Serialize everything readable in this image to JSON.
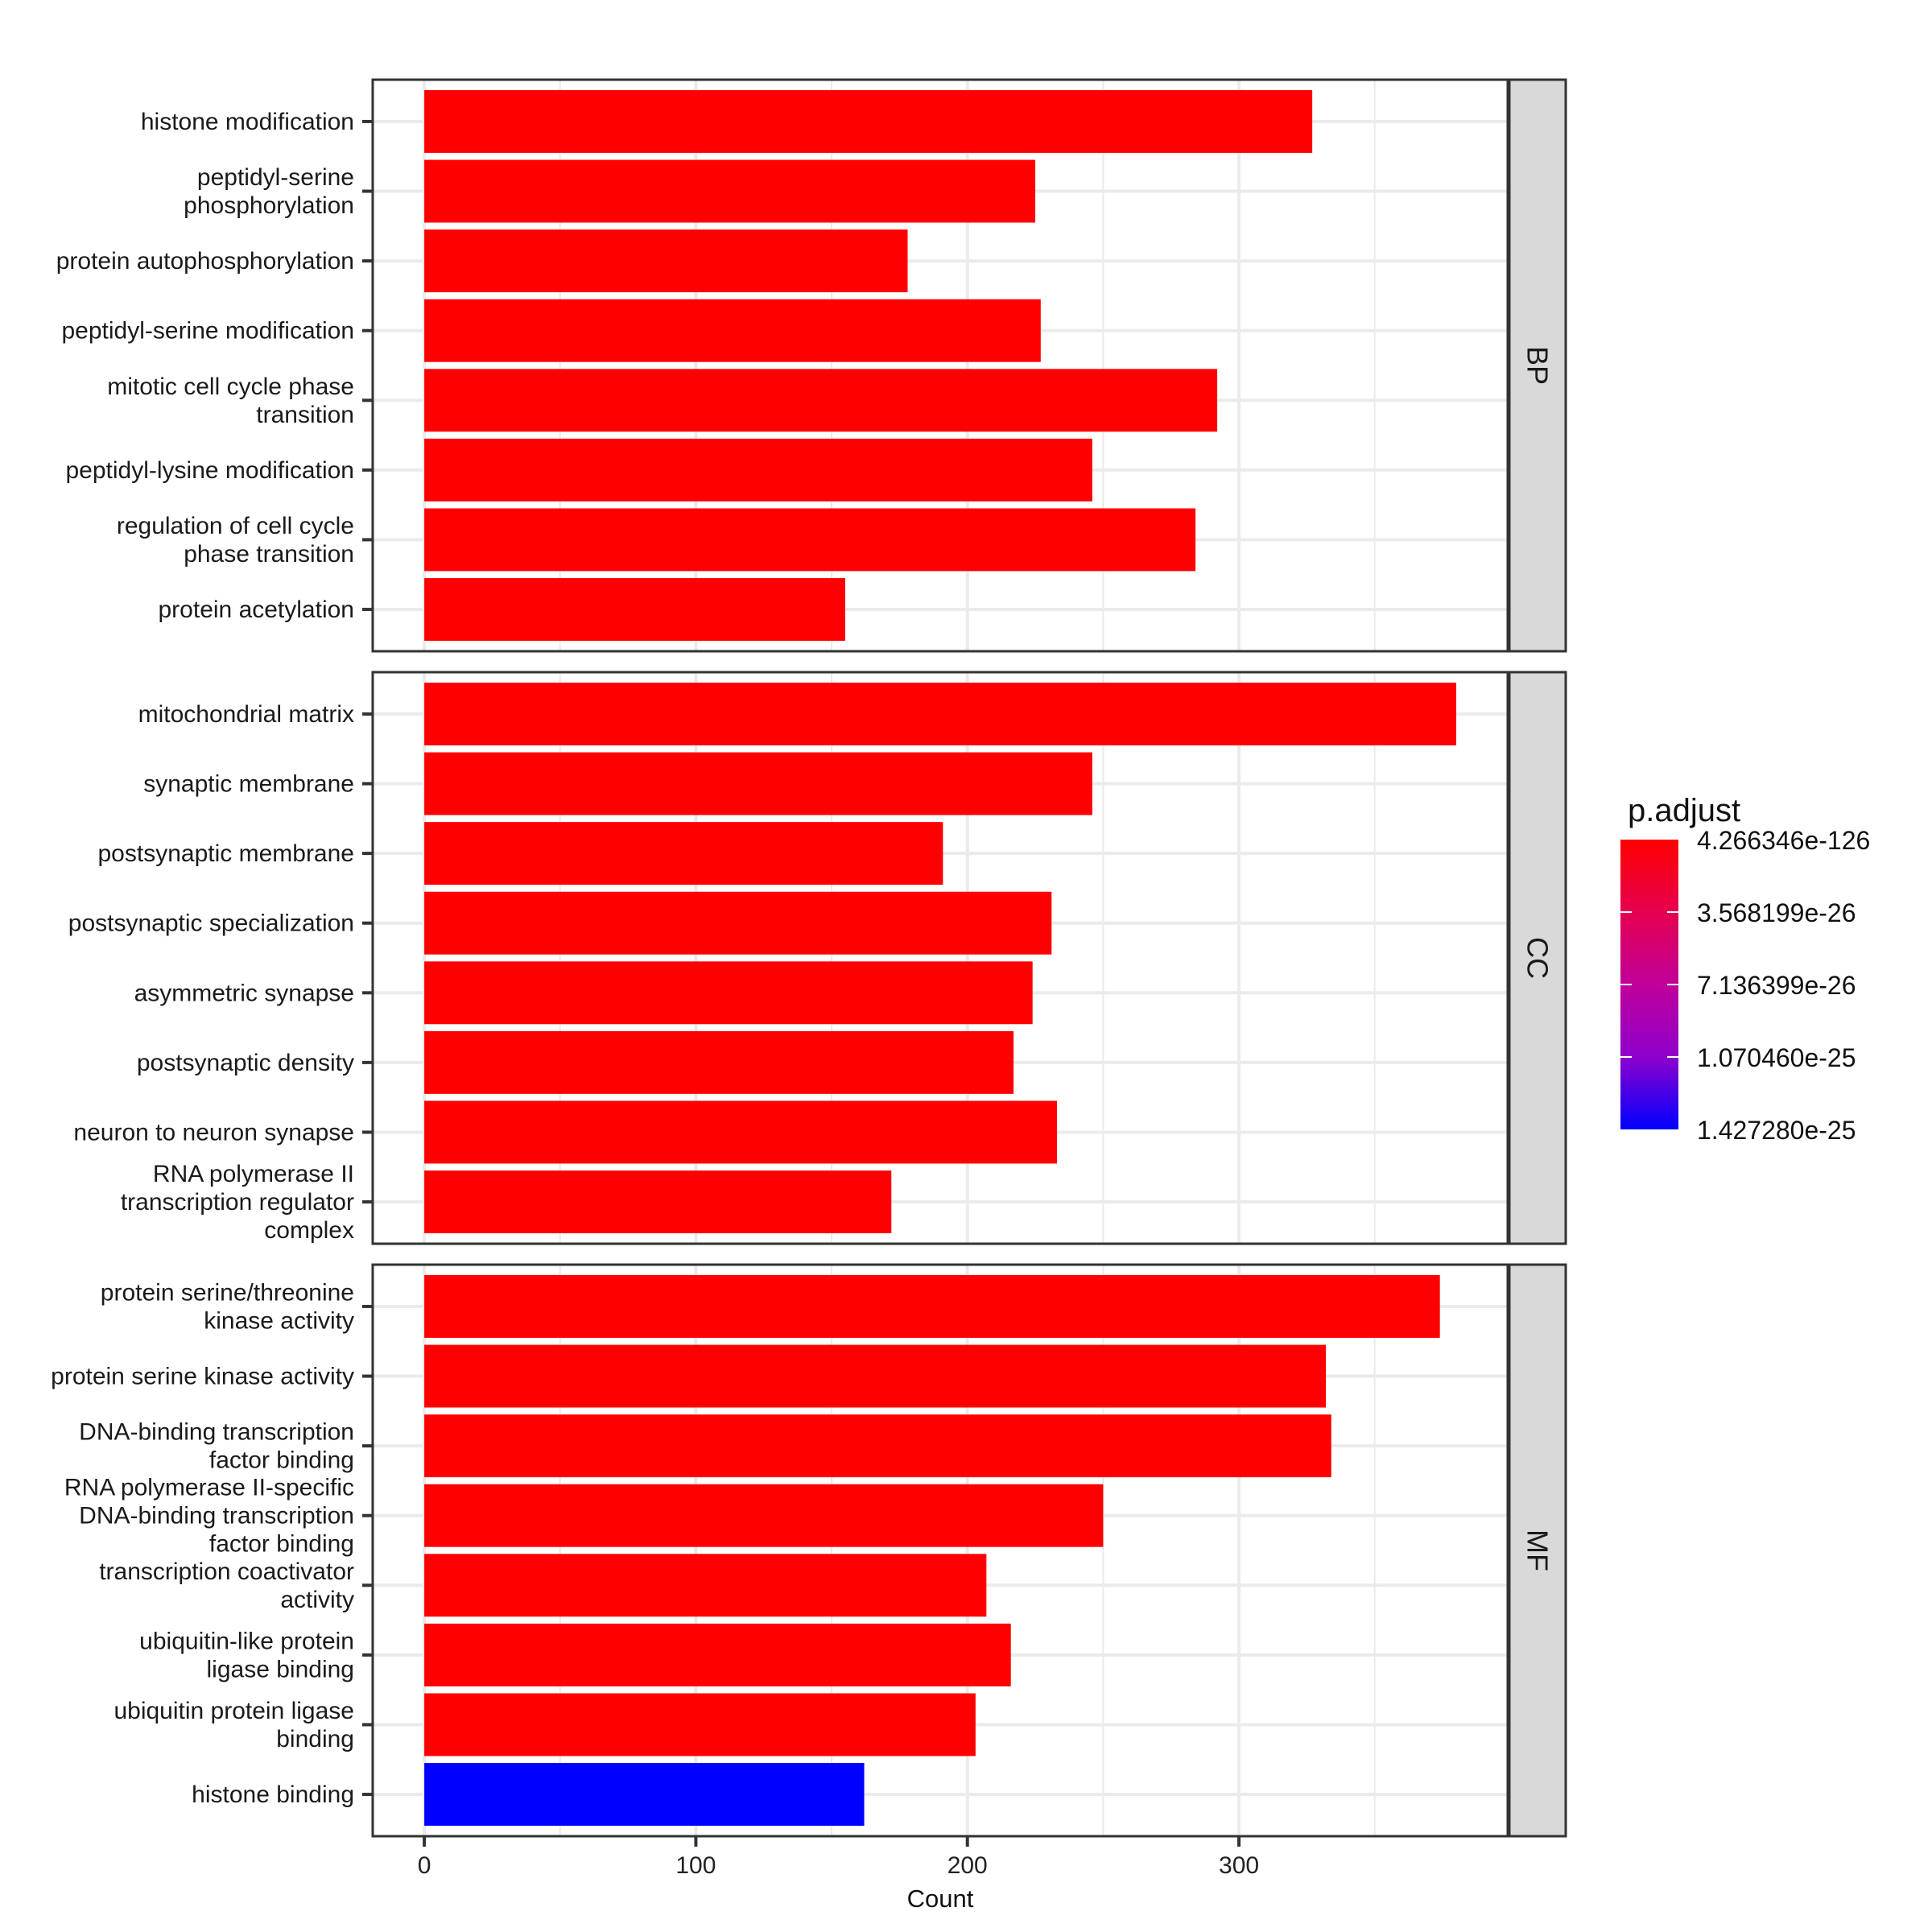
{
  "chart_data": {
    "type": "bar",
    "orientation": "horizontal",
    "faceted": true,
    "title": "",
    "xlabel": "Count",
    "ylabel": "",
    "xlim": [
      -19,
      399
    ],
    "x_ticks": [
      0,
      100,
      200,
      300
    ],
    "x_tick_labels": [
      "0",
      "100",
      "200",
      "300"
    ],
    "grid": true,
    "facets": [
      {
        "strip_label": "BP",
        "categories": [
          "histone modification",
          "peptidyl-serine\nphosphorylation",
          "protein autophosphorylation",
          "peptidyl-serine modification",
          "mitotic cell cycle phase\ntransition",
          "peptidyl-lysine modification",
          "regulation of cell cycle\nphase transition",
          "protein acetylation"
        ],
        "values": [
          327,
          225,
          178,
          227,
          292,
          246,
          284,
          155
        ],
        "colors": [
          "#FF0000",
          "#FF0000",
          "#FF0000",
          "#FF0000",
          "#FF0000",
          "#FF0000",
          "#FF0000",
          "#FF0000"
        ]
      },
      {
        "strip_label": "CC",
        "categories": [
          "mitochondrial matrix",
          "synaptic membrane",
          "postsynaptic membrane",
          "postsynaptic specialization",
          "asymmetric synapse",
          "postsynaptic density",
          "neuron to neuron synapse",
          "RNA polymerase II\ntranscription regulator\ncomplex"
        ],
        "values": [
          380,
          246,
          191,
          231,
          224,
          217,
          233,
          172
        ],
        "colors": [
          "#FF0000",
          "#FF0000",
          "#FF0000",
          "#FF0000",
          "#FF0000",
          "#FF0000",
          "#FF0000",
          "#FF0000"
        ]
      },
      {
        "strip_label": "MF",
        "categories": [
          "protein serine/threonine\nkinase activity",
          "protein serine kinase activity",
          "DNA-binding transcription\nfactor binding",
          "RNA polymerase II-specific\nDNA-binding transcription\nfactor binding",
          "transcription coactivator\nactivity",
          "ubiquitin-like protein\nligase binding",
          "ubiquitin protein ligase\nbinding",
          "histone binding"
        ],
        "values": [
          374,
          332,
          334,
          250,
          207,
          216,
          203,
          162
        ],
        "colors": [
          "#FF0000",
          "#FF0000",
          "#FF0000",
          "#FF0000",
          "#FF0000",
          "#FF0000",
          "#FF0000",
          "#0000FF"
        ]
      }
    ],
    "legend": {
      "title": "p.adjust",
      "type": "colorbar",
      "placement": "right",
      "labels": [
        "4.266346e-126",
        "3.568199e-26",
        "7.136399e-26",
        "1.070460e-25",
        "1.427280e-25"
      ],
      "color_low": "#FF0000",
      "color_high": "#0000FF"
    }
  }
}
